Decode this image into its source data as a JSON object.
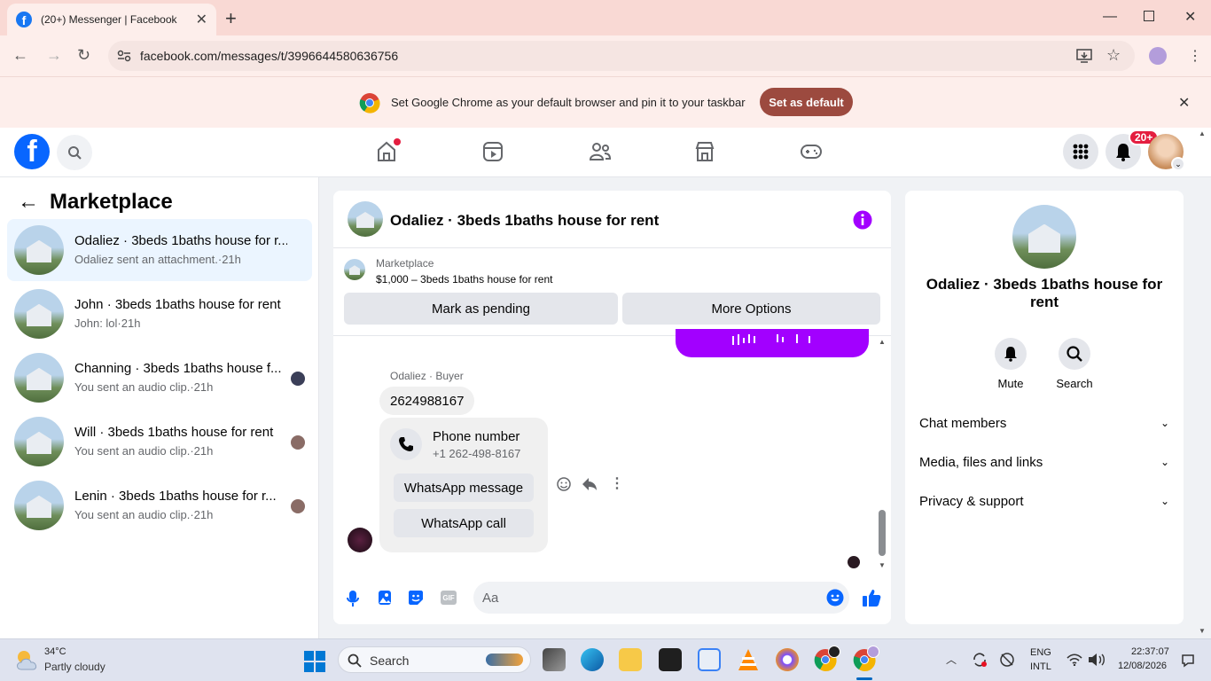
{
  "browser": {
    "tab_title": "(20+) Messenger | Facebook",
    "url": "facebook.com/messages/t/3996644580636756",
    "infobar_message": "Set Google Chrome as your default browser and pin it to your taskbar",
    "infobar_button": "Set as default"
  },
  "fb_header": {
    "notification_badge": "20+",
    "nav_icons": [
      "home-icon",
      "video-icon",
      "friends-icon",
      "marketplace-icon",
      "gaming-icon"
    ]
  },
  "left_panel": {
    "title": "Marketplace",
    "conversations": [
      {
        "name": "Odaliez · 3beds 1baths house for r...",
        "snippet": "Odaliez sent an attachment.·21h",
        "active": true
      },
      {
        "name": "John · 3beds 1baths house for rent",
        "snippet": "John: lol·21h",
        "active": false
      },
      {
        "name": "Channing · 3beds 1baths house f...",
        "snippet": "You sent an audio clip.·21h",
        "active": false
      },
      {
        "name": "Will · 3beds 1baths house for rent",
        "snippet": "You sent an audio clip.·21h",
        "active": false
      },
      {
        "name": "Lenin · 3beds 1baths house for r...",
        "snippet": "You sent an audio clip.·21h",
        "active": false
      }
    ]
  },
  "chat": {
    "title": "Odaliez · 3beds 1baths house for rent",
    "marketplace_label": "Marketplace",
    "listing": "$1,000 – 3beds 1baths house for rent",
    "mark_pending": "Mark as pending",
    "more_options": "More Options",
    "sender_label": "Odaliez · Buyer",
    "message_number": "2624988167",
    "phone_card": {
      "title": "Phone number",
      "number": "+1 262-498-8167",
      "whatsapp_message": "WhatsApp message",
      "whatsapp_call": "WhatsApp call"
    },
    "input_placeholder": "Aa",
    "accent_color": "#a200ff"
  },
  "right_panel": {
    "name": "Odaliez · 3beds 1baths house for rent",
    "mute": "Mute",
    "search": "Search",
    "sections": [
      "Chat members",
      "Media, files and links",
      "Privacy & support"
    ]
  },
  "taskbar": {
    "temperature": "34°C",
    "weather": "Partly cloudy",
    "search": "Search",
    "lang_line1": "ENG",
    "lang_line2": "INTL",
    "time": "22:37:07",
    "date": "12/08/2026"
  }
}
